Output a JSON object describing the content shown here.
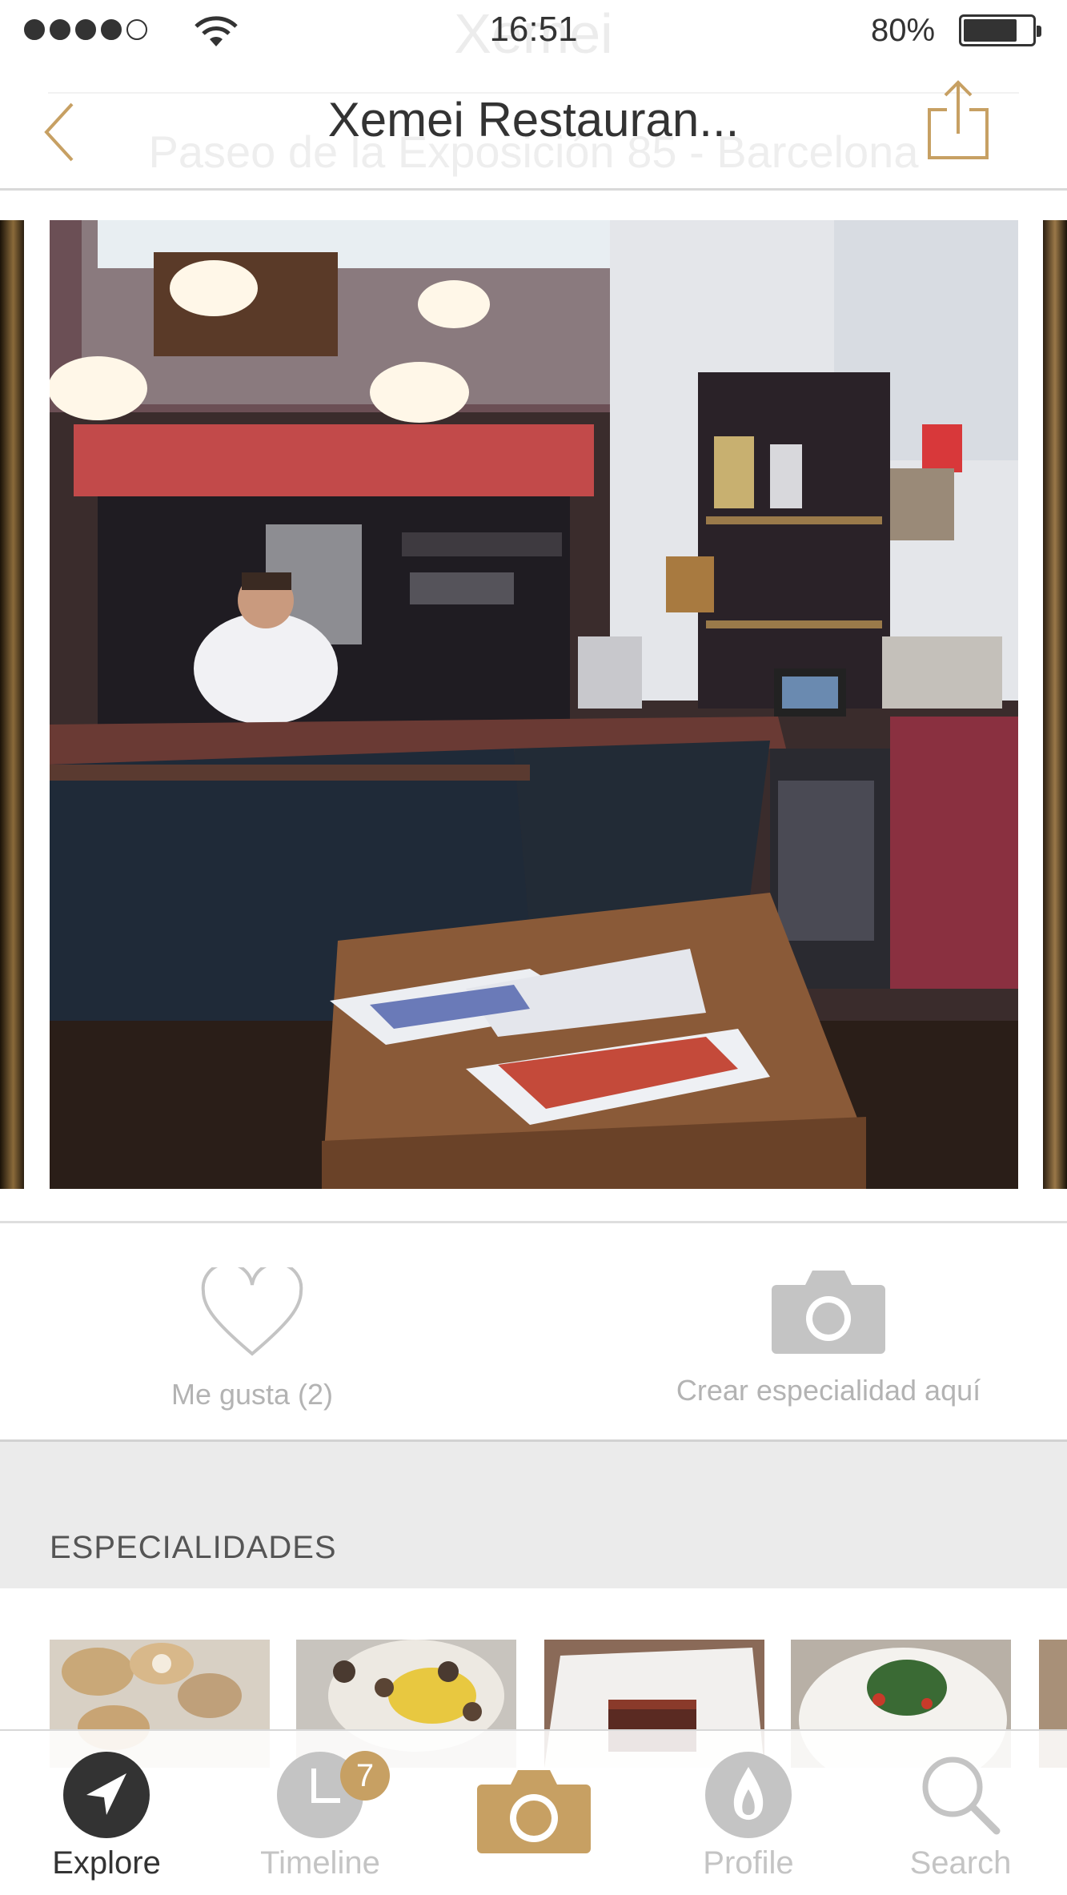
{
  "status_bar": {
    "time": "16:51",
    "ghost_text": "Xemei",
    "battery_percent": "80%",
    "battery_level": 0.8,
    "signal_bars_filled": 4,
    "signal_bars_total": 5
  },
  "nav": {
    "title": "Xemei Restauran...",
    "subtitle_ghost": "Paseo de la Exposición 85 - Barcelona",
    "back_icon": "chevron-left-icon",
    "share_icon": "share-icon",
    "accent_color": "#c7a063"
  },
  "actions": {
    "like_label": "Me gusta (2)",
    "camera_label": "Crear especialidad aquí"
  },
  "section": {
    "title": "ESPECIALIDADES"
  },
  "tabs": [
    {
      "label": "Explore",
      "icon": "compass-arrow-icon",
      "active": true
    },
    {
      "label": "Timeline",
      "icon": "clock-icon",
      "badge": "7"
    },
    {
      "label": "",
      "icon": "camera-icon"
    },
    {
      "label": "Profile",
      "icon": "flame-icon"
    },
    {
      "label": "Search",
      "icon": "search-icon"
    }
  ]
}
